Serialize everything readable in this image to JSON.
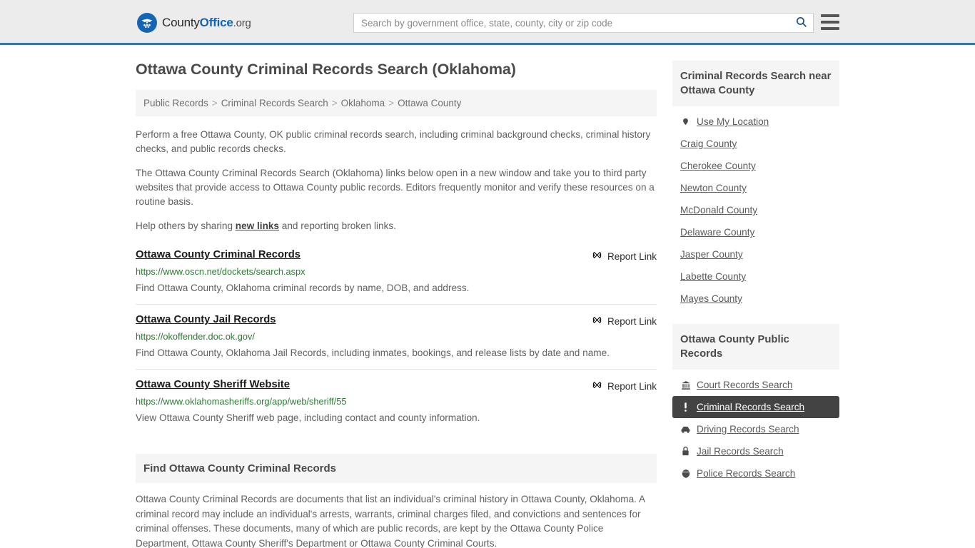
{
  "header": {
    "brand": {
      "part1": "County",
      "part2": "Office",
      "part3": ".org",
      "logo_icon": "eagle-shield-logo"
    },
    "search": {
      "placeholder": "Search by government office, state, county, city or zip code",
      "value": "",
      "icon": "search-icon"
    },
    "menu_icon": "hamburger-menu-icon",
    "accent_color": "#3a75a8"
  },
  "main": {
    "title": "Ottawa County Criminal Records Search (Oklahoma)",
    "breadcrumb": [
      {
        "label": "Public Records"
      },
      {
        "label": "Criminal Records Search"
      },
      {
        "label": "Oklahoma"
      },
      {
        "label": "Ottawa County"
      }
    ],
    "breadcrumb_separator": ">",
    "paragraphs": {
      "p1": "Perform a free Ottawa County, OK public criminal records search, including criminal background checks, criminal history checks, and public records checks.",
      "p2": "The Ottawa County Criminal Records Search (Oklahoma) links below open in a new window and take you to third party websites that provide access to Ottawa County public records. Editors frequently monitor and verify these resources on a routine basis.",
      "p3_before": "Help others by sharing ",
      "p3_link": "new links",
      "p3_after": " and reporting broken links."
    },
    "report_link_label": "Report Link",
    "report_link_icon": "broken-link-icon",
    "links": [
      {
        "title": "Ottawa County Criminal Records",
        "url": "https://www.oscn.net/dockets/search.aspx",
        "description": "Find Ottawa County, Oklahoma criminal records by name, DOB, and address."
      },
      {
        "title": "Ottawa County Jail Records",
        "url": "https://okoffender.doc.ok.gov/",
        "description": "Find Ottawa County, Oklahoma Jail Records, including inmates, bookings, and release lists by date and name."
      },
      {
        "title": "Ottawa County Sheriff Website",
        "url": "https://www.oklahomasheriffs.org/app/web/sheriff/55",
        "description": "View Ottawa County Sheriff web page, including contact and county information."
      }
    ],
    "section": {
      "heading": "Find Ottawa County Criminal Records",
      "body": "Ottawa County Criminal Records are documents that list an individual's criminal history in Ottawa County, Oklahoma. A criminal record may include an individual's arrests, warrants, criminal charges filed, and convictions and sentences for criminal offenses. These documents, many of which are public records, are kept by the Ottawa County Police Department, Ottawa County Sheriff's Department or Ottawa County Criminal Courts."
    }
  },
  "sidebar": {
    "nearby": {
      "heading": "Criminal Records Search near Ottawa County",
      "items": [
        {
          "label": "Use My Location",
          "icon": "map-pin-icon"
        },
        {
          "label": "Craig County",
          "icon": ""
        },
        {
          "label": "Cherokee County",
          "icon": ""
        },
        {
          "label": "Newton County",
          "icon": ""
        },
        {
          "label": "McDonald County",
          "icon": ""
        },
        {
          "label": "Delaware County",
          "icon": ""
        },
        {
          "label": "Jasper County",
          "icon": ""
        },
        {
          "label": "Labette County",
          "icon": ""
        },
        {
          "label": "Mayes County",
          "icon": ""
        }
      ]
    },
    "public_records": {
      "heading": "Ottawa County Public Records",
      "items": [
        {
          "label": "Court Records Search",
          "icon": "courthouse-icon",
          "active": false
        },
        {
          "label": "Criminal Records Search",
          "icon": "exclamation-icon",
          "active": true
        },
        {
          "label": "Driving Records Search",
          "icon": "car-icon",
          "active": false
        },
        {
          "label": "Jail Records Search",
          "icon": "lock-icon",
          "active": false
        },
        {
          "label": "Police Records Search",
          "icon": "police-badge-icon",
          "active": false
        }
      ],
      "active_background": "#434343"
    }
  }
}
